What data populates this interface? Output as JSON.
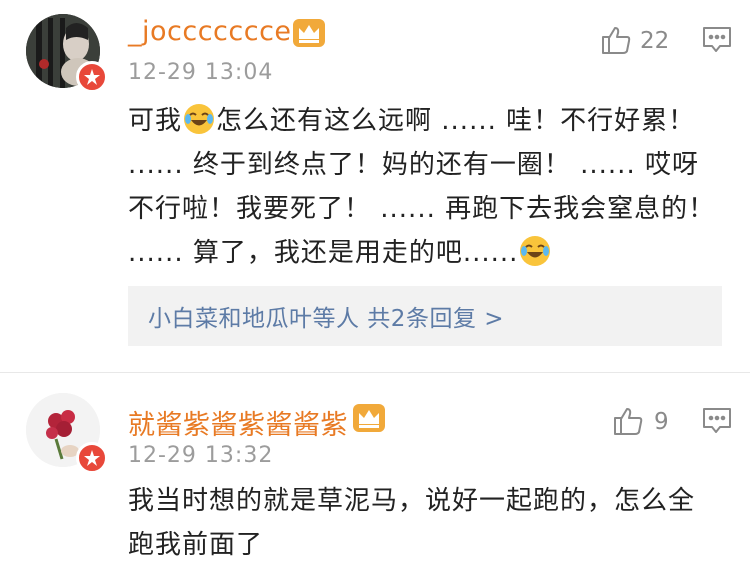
{
  "comments": [
    {
      "username": "_joccccccce",
      "timestamp": "12-29 13:04",
      "like_count": "22",
      "content_part1": "可我",
      "content_part2": "怎么还有这么远啊 ...... 哇！不行好累！ ...... 终于到终点了！妈的还有一圈！ ...... 哎呀不行啦！我要死了！ ...... 再跑下去我会窒息的！ ...... 算了，我还是用走的吧......",
      "replies_text": "小白菜和地瓜叶等人  共2条回复 >"
    },
    {
      "username": "就酱紫酱紫酱酱紫",
      "timestamp": "12-29 13:32",
      "like_count": "9",
      "content": "我当时想的就是草泥马，说好一起跑的，怎么全跑我前面了"
    }
  ],
  "colors": {
    "username": "#e87a24",
    "timestamp": "#9c9c9c",
    "replies_link": "#5d7ba6",
    "badge": "#e8483a",
    "replies_bg": "#f2f2f2"
  },
  "icons": {
    "member_crown": "crown-icon",
    "verified_badge": "star-badge-icon",
    "like": "thumbs-up-icon",
    "reply": "comment-icon",
    "emoji": "laughing-tears-emoji"
  }
}
